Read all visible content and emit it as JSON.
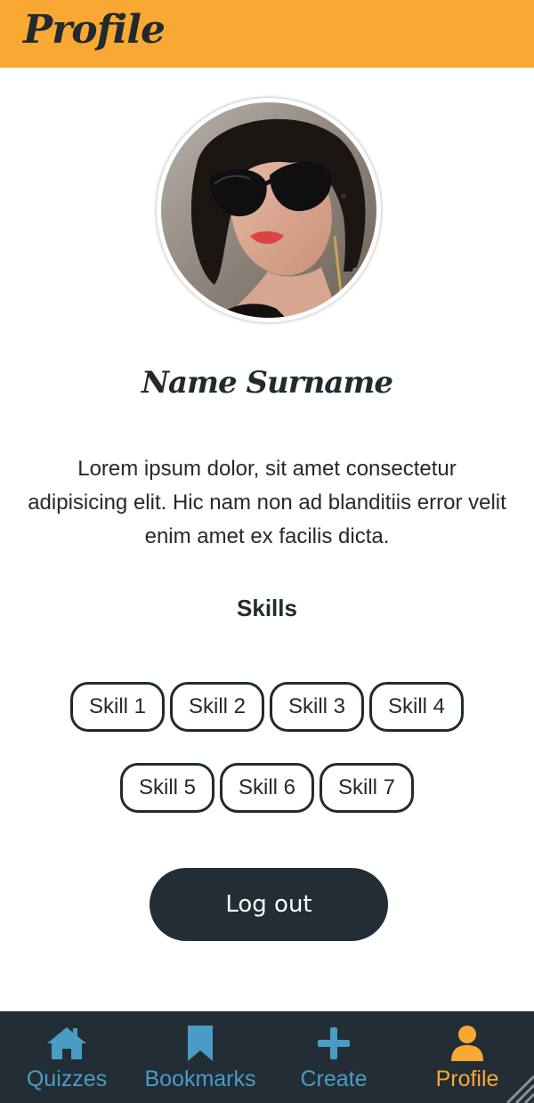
{
  "header": {
    "title": "Profile",
    "background": "#f9a933"
  },
  "profile": {
    "avatar_alt": "profile photo",
    "name": "Name Surname",
    "bio": "Lorem ipsum dolor, sit amet consectetur adipisicing elit. Hic nam non ad blanditiis error velit enim amet ex facilis dicta."
  },
  "skills": {
    "heading": "Skills",
    "items": [
      "Skill 1",
      "Skill 2",
      "Skill 3",
      "Skill 4",
      "Skill 5",
      "Skill 6",
      "Skill 7"
    ]
  },
  "actions": {
    "logout_label": "Log out"
  },
  "nav": {
    "items": [
      {
        "label": "Quizzes",
        "icon": "home-icon",
        "active": false
      },
      {
        "label": "Bookmarks",
        "icon": "bookmark-icon",
        "active": false
      },
      {
        "label": "Create",
        "icon": "plus-icon",
        "active": false
      },
      {
        "label": "Profile",
        "icon": "user-icon",
        "active": true
      }
    ],
    "inactive_color": "#4a9cc4",
    "active_color": "#f9a933",
    "background": "#222d35"
  }
}
